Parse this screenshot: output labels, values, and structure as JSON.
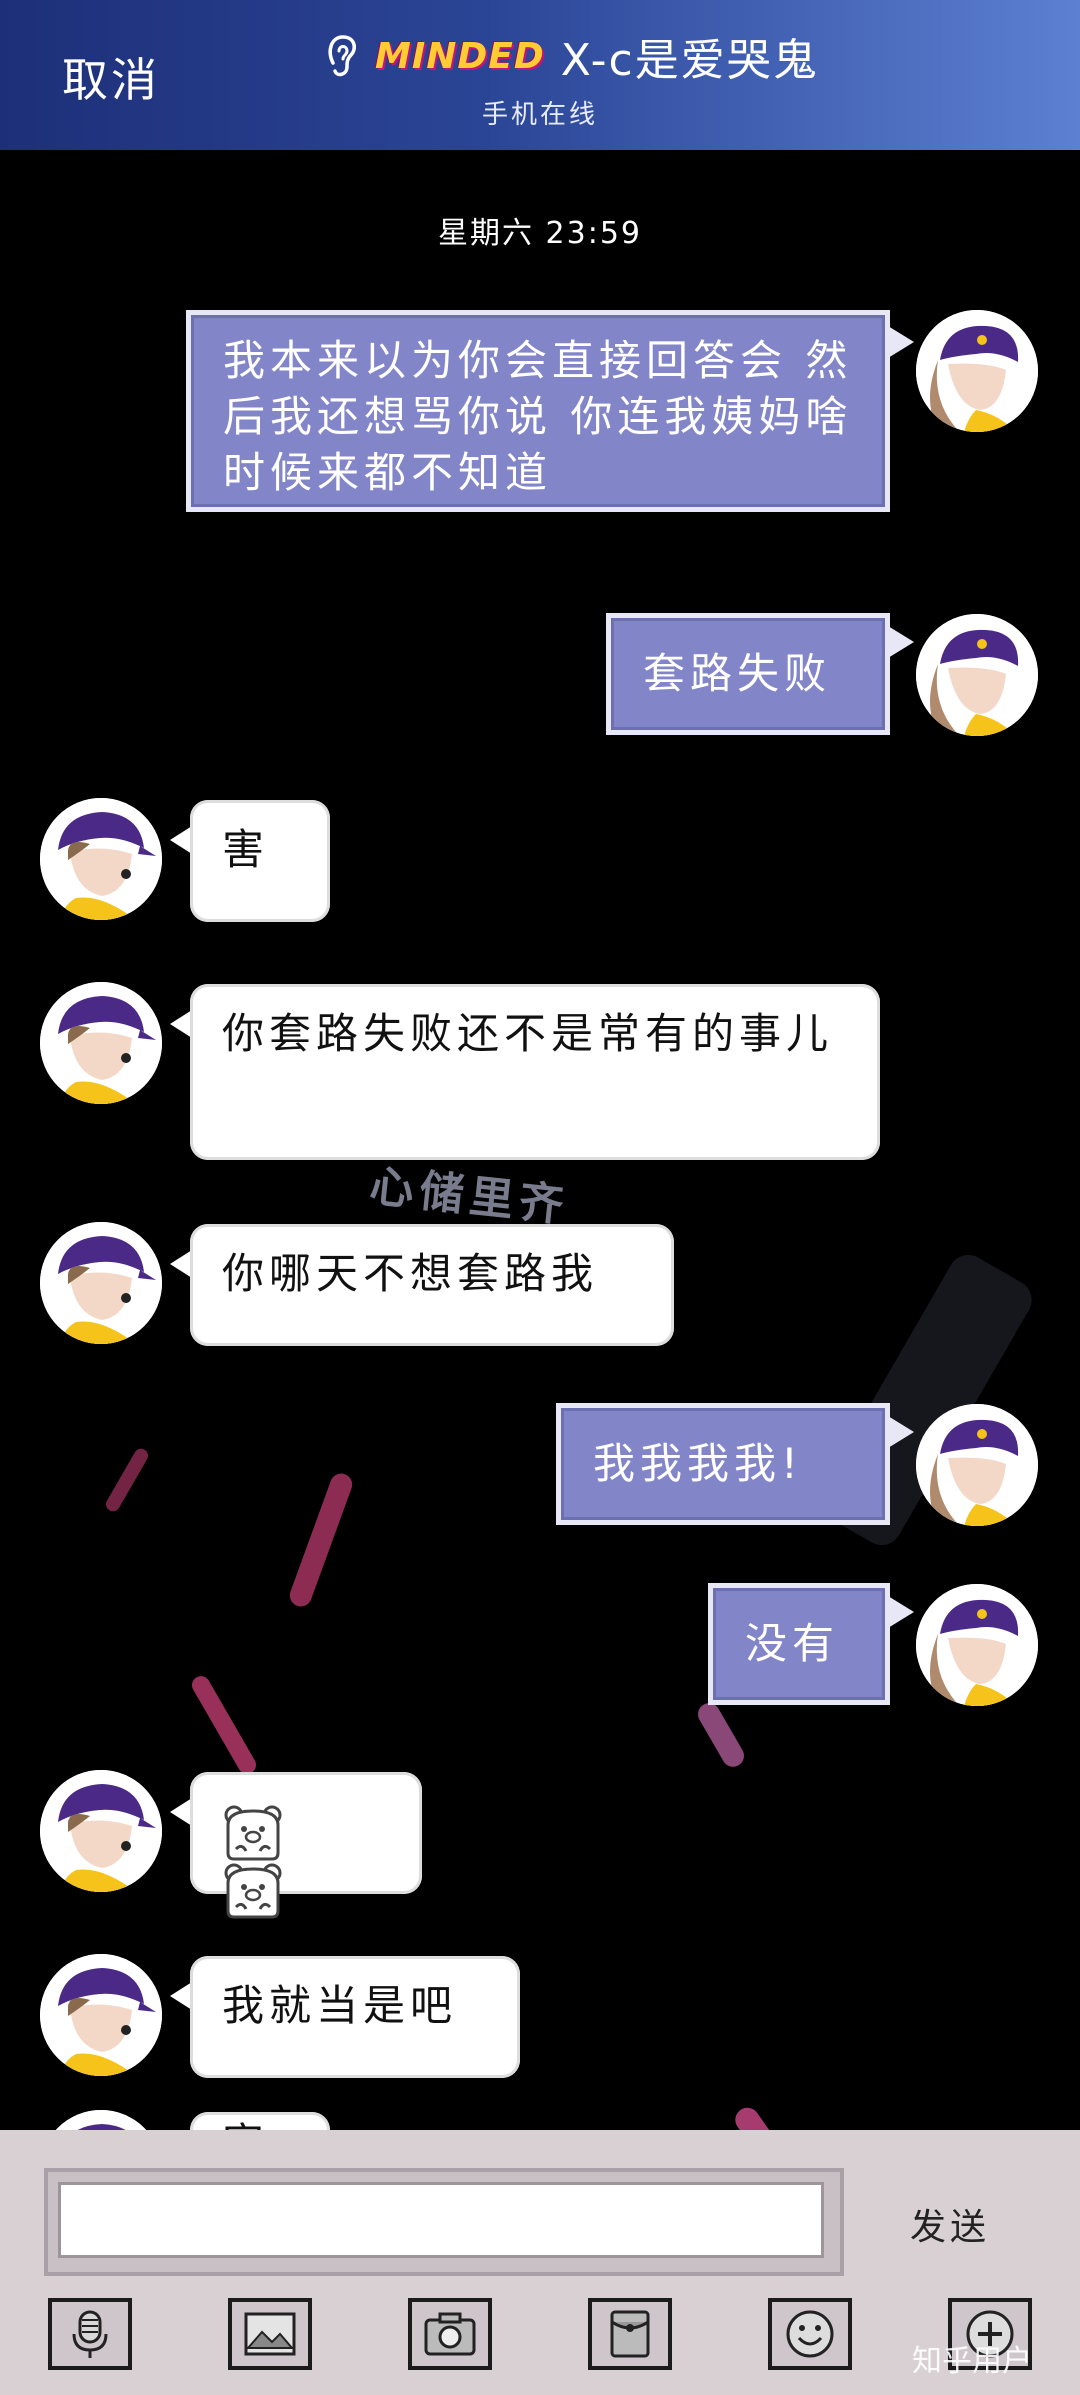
{
  "header": {
    "cancel_label": "取消",
    "brand": "MINDED",
    "title": "X-c是爱哭鬼",
    "status": "手机在线"
  },
  "chat": {
    "timestamp": "星期六 23:59",
    "messages": [
      {
        "side": "sent",
        "text": "我本来以为你会直接回答会 然后我还想骂你说 你连我姨妈啥时候来都不知道"
      },
      {
        "side": "sent",
        "text": "套路失败"
      },
      {
        "side": "received",
        "text": "害"
      },
      {
        "side": "received",
        "text": "你套路失败还不是常有的事儿"
      },
      {
        "side": "received",
        "text": "你哪天不想套路我"
      },
      {
        "side": "sent",
        "text": "我我我我!"
      },
      {
        "side": "sent",
        "text": "没有"
      },
      {
        "side": "received",
        "sticker": "bear-emoji x2"
      },
      {
        "side": "received",
        "text": "我就当是吧"
      },
      {
        "side": "received",
        "text": "害"
      }
    ]
  },
  "input": {
    "value": "",
    "placeholder": "",
    "send_label": "发送"
  },
  "toolbar": {
    "items": [
      "microphone-icon",
      "image-icon",
      "camera-icon",
      "red-packet-icon",
      "emoji-icon",
      "plus-icon"
    ]
  },
  "watermark": "知乎用户",
  "colors": {
    "header_start": "#1d2f78",
    "header_end": "#5d80d2",
    "sent_bubble": "#8385c9",
    "received_bubble": "#ffffff",
    "input_bar": "#d9d0d4"
  }
}
